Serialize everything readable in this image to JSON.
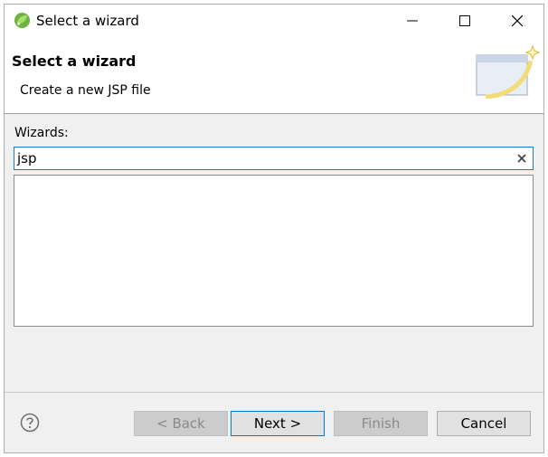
{
  "window": {
    "title": "Select a wizard"
  },
  "header": {
    "title": "Select a wizard",
    "description": "Create a new JSP file"
  },
  "wizards": {
    "label": "Wizards:",
    "search_value": "jsp"
  },
  "footer": {
    "back_label": "< Back",
    "next_label": "Next >",
    "finish_label": "Finish",
    "cancel_label": "Cancel"
  },
  "icons": {
    "app": "eclipse-spring-leaf-icon",
    "minimize": "minimize-icon",
    "maximize": "maximize-icon",
    "close": "close-icon",
    "clear": "clear-x-icon",
    "help": "help-question-icon",
    "banner": "wizard-banner-icon"
  },
  "colors": {
    "accent": "#0078d7",
    "search_border": "#1f7cc4",
    "app_icon": "#6db33f"
  }
}
